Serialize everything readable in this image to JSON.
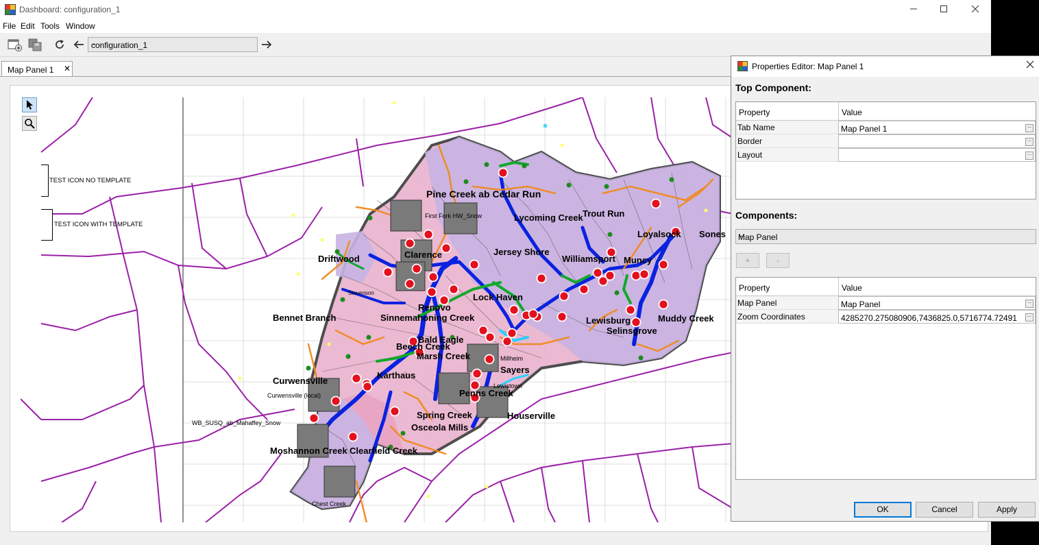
{
  "window": {
    "title": "Dashboard: configuration_1"
  },
  "menu": {
    "file": "File",
    "edit": "Edit",
    "tools": "Tools",
    "window": "Window"
  },
  "toolbar": {
    "configuration": "configuration_1"
  },
  "tab": {
    "label": "Map Panel 1"
  },
  "map": {
    "legend": {
      "no_template": "TEST ICON NO TEMPLATE",
      "with_template": "TEST ICON WITH TEMPLATE"
    },
    "labels": [
      "Pine Creek ab Cedar Run",
      "Bennet Branch",
      "Sinnemahoning Creek",
      "Curwensville",
      "Curwensville (local)",
      "WB_SUSQ_ab_Mahaffey_Snow",
      "First Fork HW_Snow",
      "Renovo",
      "Lock Haven",
      "Lewisburg",
      "Selinsgrove",
      "Beech Creek",
      "Marsh Creek",
      "Sayers",
      "Millheim",
      "Houserville",
      "Spring Creek",
      "Jersey Shore",
      "Williamsport",
      "Loyalsock",
      "Muncy",
      "Chest Creek",
      "Karthaus",
      "Driftwood",
      "Stevenson",
      "Clarence",
      "Muddy Creek",
      "Lycoming Creek",
      "Trout Run",
      "Penns Creek",
      "Bald Eagle",
      "Lewistown",
      "Sones",
      "Moshannon Creek",
      "Clearfield Creek",
      "Osceola Mills"
    ]
  },
  "dialog": {
    "title": "Properties Editor: Map Panel 1",
    "top_component_heading": "Top Component:",
    "table_header": {
      "property": "Property",
      "value": "Value"
    },
    "top_rows": [
      {
        "key": "Tab Name",
        "value": "Map Panel 1"
      },
      {
        "key": "Border",
        "value": ""
      },
      {
        "key": "Layout",
        "value": ""
      }
    ],
    "components_heading": "Components:",
    "component_select": "Map Panel",
    "add_label": "+",
    "remove_label": "-",
    "comp_rows": [
      {
        "key": "Map Panel",
        "value": "Map Panel"
      },
      {
        "key": "Zoom Coordinates",
        "value": "4285270.275080906,7436825.0,5716774.72491"
      }
    ],
    "buttons": {
      "ok": "OK",
      "cancel": "Cancel",
      "apply": "Apply"
    }
  }
}
